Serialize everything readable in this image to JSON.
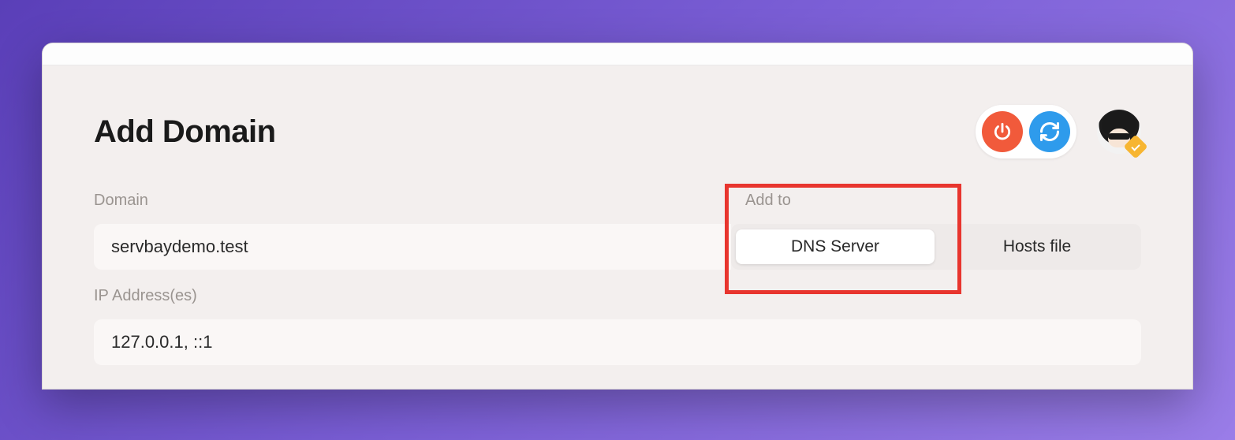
{
  "page": {
    "title": "Add Domain"
  },
  "form": {
    "domain": {
      "label": "Domain",
      "value": "servbaydemo.test"
    },
    "add_to": {
      "label": "Add to",
      "options": {
        "dns": "DNS Server",
        "hosts": "Hosts file"
      },
      "selected": "dns"
    },
    "ip": {
      "label": "IP Address(es)",
      "value": "127.0.0.1, ::1"
    }
  },
  "icons": {
    "power": "power-icon",
    "refresh": "refresh-icon"
  }
}
